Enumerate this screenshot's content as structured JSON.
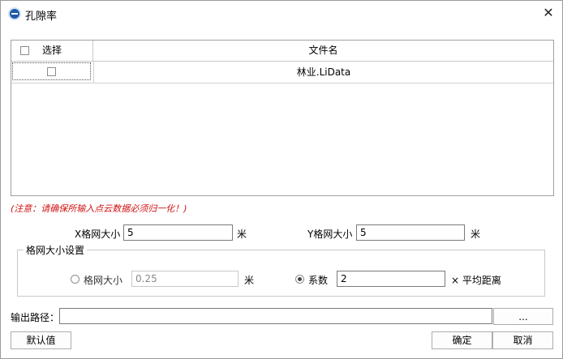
{
  "window": {
    "title": "孔隙率",
    "close_glyph": "✕",
    "logo": "lidar-logo-icon"
  },
  "grid": {
    "headers": {
      "select": "选择",
      "file_name": "文件名"
    },
    "rows": [
      {
        "checked": false,
        "file_name": "林业.LiData"
      }
    ]
  },
  "note": "(注意：请确保所输入点云数据必须归一化！)",
  "grid_size": {
    "x_label": "X格网大小",
    "x_value": "5",
    "x_unit": "米",
    "y_label": "Y格网大小",
    "y_value": "5",
    "y_unit": "米"
  },
  "settings": {
    "legend": "格网大小设置",
    "option_grid": {
      "label": "格网大小",
      "value": "0.25",
      "unit": "米",
      "selected": false
    },
    "option_coef": {
      "label": "系数",
      "value": "2",
      "suffix": "× 平均距离",
      "selected": true
    }
  },
  "output": {
    "label": "输出路径：",
    "value": "",
    "browse_label": "..."
  },
  "buttons": {
    "default": "默认值",
    "ok": "确定",
    "cancel": "取消"
  }
}
